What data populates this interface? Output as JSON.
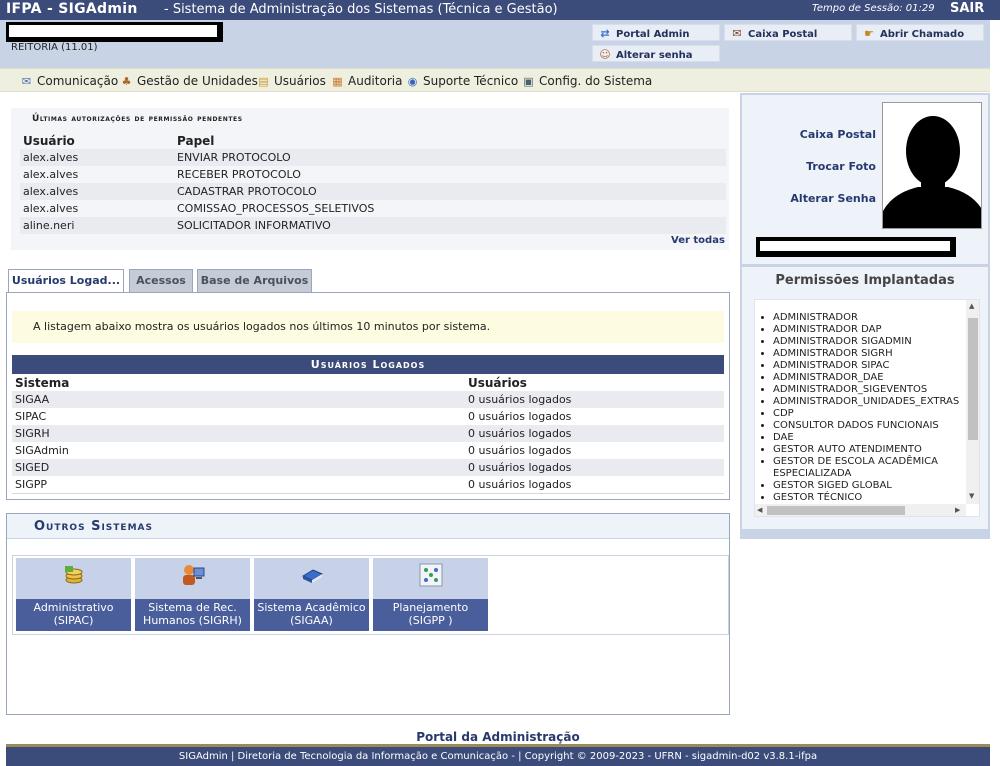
{
  "topbar": {
    "system_name": "IFPA - SIGAdmin",
    "description": "- Sistema de Administração dos Sistemas (Técnica e Gestão)",
    "session_label": "Tempo de Sessão: 01:29",
    "logout_label": "SAIR"
  },
  "header": {
    "unit": "REITORIA (11.01)",
    "buttons": {
      "portal_admin": "Portal Admin",
      "caixa_postal": "Caixa Postal",
      "abrir_chamado": "Abrir Chamado",
      "alterar_senha": "Alterar senha"
    }
  },
  "menu": {
    "items": [
      "Comunicação",
      "Gestão de Unidades",
      "Usuários",
      "Auditoria",
      "Suporte Técnico",
      "Config. do Sistema"
    ]
  },
  "pending": {
    "caption": "Últimas autorizações de permissão pendentes",
    "col_user": "Usuário",
    "col_role": "Papel",
    "rows": [
      {
        "user": "alex.alves",
        "role": "ENVIAR PROTOCOLO"
      },
      {
        "user": "alex.alves",
        "role": "RECEBER PROTOCOLO"
      },
      {
        "user": "alex.alves",
        "role": "CADASTRAR PROTOCOLO"
      },
      {
        "user": "alex.alves",
        "role": "COMISSAO_PROCESSOS_SELETIVOS"
      },
      {
        "user": "aline.neri",
        "role": "SOLICITADOR INFORMATIVO"
      }
    ],
    "view_all": "Ver todas"
  },
  "tabs": [
    "Usuários Logad...",
    "Acessos",
    "Base de Arquivos"
  ],
  "logged": {
    "info": "A listagem abaixo mostra os usuários logados nos últimos 10 minutos por sistema.",
    "title": "Usuários Logados",
    "col_system": "Sistema",
    "col_users": "Usuários",
    "rows": [
      {
        "system": "SIGAA",
        "users": "0 usuários logados"
      },
      {
        "system": "SIPAC",
        "users": "0 usuários logados"
      },
      {
        "system": "SIGRH",
        "users": "0 usuários logados"
      },
      {
        "system": "SIGAdmin",
        "users": "0 usuários logados"
      },
      {
        "system": "SIGED",
        "users": "0 usuários logados"
      },
      {
        "system": "SIGPP",
        "users": "0 usuários logados"
      }
    ]
  },
  "others": {
    "title": "Outros Sistemas",
    "systems": [
      {
        "line1": "Administrativo",
        "line2": "(SIPAC)",
        "icon": "coins-icon"
      },
      {
        "line1": "Sistema de Rec.",
        "line2": "Humanos (SIGRH)",
        "icon": "user-computer-icon"
      },
      {
        "line1": "Sistema Acadêmico",
        "line2": "(SIGAA)",
        "icon": "book-icon"
      },
      {
        "line1": "Planejamento",
        "line2": "(SIGPP )",
        "icon": "network-icon"
      }
    ]
  },
  "profile": {
    "caixa_postal": "Caixa Postal",
    "trocar_foto": "Trocar Foto",
    "alterar_senha": "Alterar Senha"
  },
  "permissions": {
    "title": "Permissões Implantadas",
    "items": [
      "ADMINISTRADOR",
      "ADMINISTRADOR DAP",
      "ADMINISTRADOR SIGADMIN",
      "ADMINISTRADOR SIGRH",
      "ADMINISTRADOR SIPAC",
      "ADMINISTRADOR_DAE",
      "ADMINISTRADOR_SIGEVENTOS",
      "ADMINISTRADOR_UNIDADES_EXTRAS",
      "CDP",
      "CONSULTOR DADOS FUNCIONAIS",
      "DAE",
      "GESTOR AUTO ATENDIMENTO",
      "GESTOR DE ESCOLA ACADÊMICA ESPECIALIZADA",
      "GESTOR SIGED GLOBAL",
      "GESTOR TÉCNICO"
    ]
  },
  "footer": {
    "portal_link": "Portal da Administração",
    "text": "SIGAdmin | Diretoria de Tecnologia da Informação e Comunicação - | Copyright © 2009-2023 - UFRN - sigadmin-d02 v3.8.1-ifpa"
  },
  "colors": {
    "header_dark": "#3b4b7a",
    "header_light": "#c8d3e6",
    "link": "#263a6e",
    "menu_bg": "#efefe0",
    "tile_label": "#4a5e9c"
  }
}
